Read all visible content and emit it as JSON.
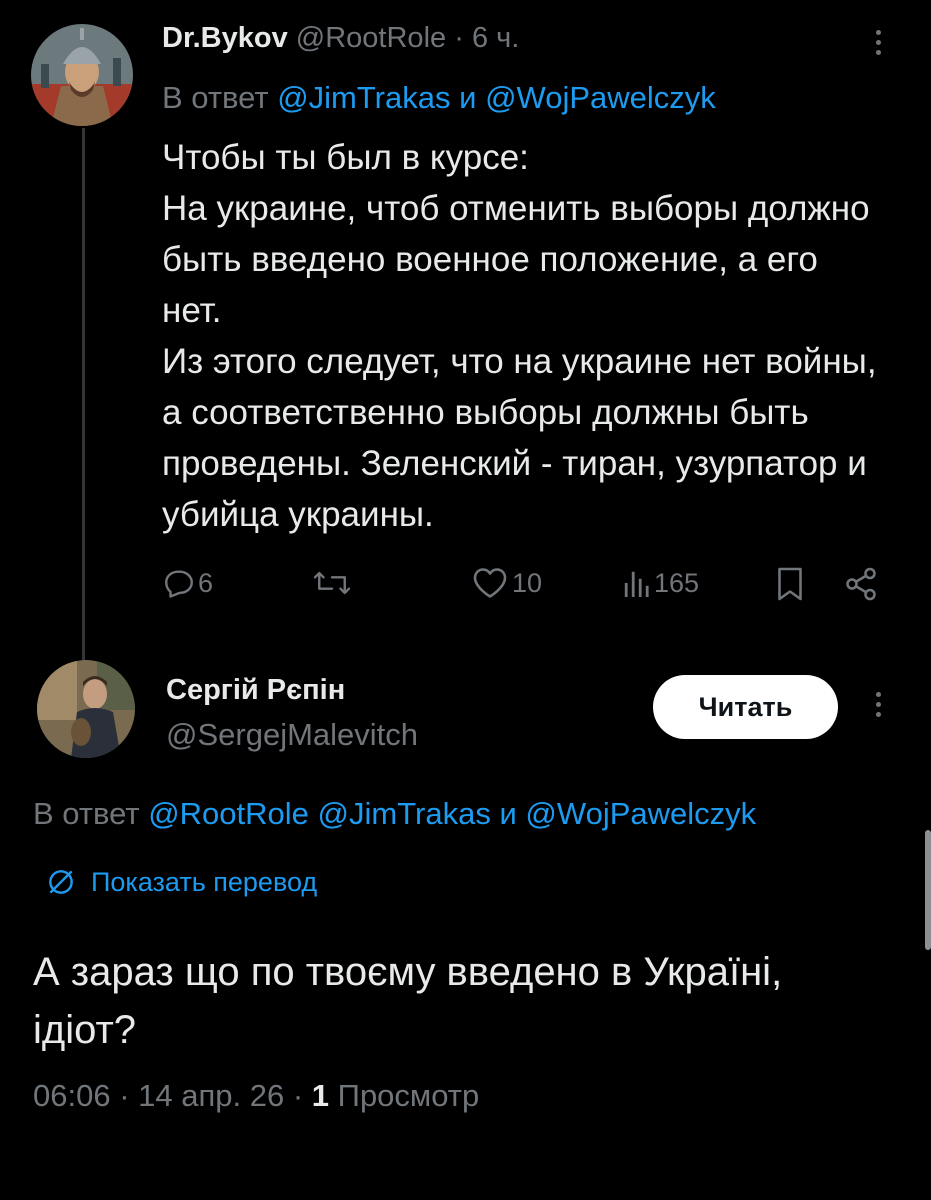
{
  "tweet1": {
    "author_name": "Dr.Bykov",
    "author_handle": "@RootRole",
    "separator": "·",
    "time_ago": "6 ч.",
    "reply_prefix": "В ответ",
    "reply_user1": "@JimTrakas",
    "reply_and": "и",
    "reply_user2": "@WojPawelczyk",
    "text": "Чтобы ты был в курсе:\nНа украине, чтоб отменить выборы должно быть введено военное положение, а его нет.\nИз этого следует, что на украине нет войны, а соответственно выборы должны быть проведены. Зеленский - тиран, узурпатор и убийца украины.",
    "replies": "6",
    "likes": "10",
    "views": "165"
  },
  "tweet2": {
    "author_name": "Сергій Рєпін",
    "author_handle": "@SergejMalevitch",
    "follow_label": "Читать",
    "reply_prefix": "В ответ",
    "reply_user1": "@RootRole",
    "reply_user2": "@JimTrakas",
    "reply_and": "и",
    "reply_user3": "@WojPawelczyk",
    "translate_label": "Показать перевод",
    "text": "А зараз що по твоєму введено в Україні, ідіот?",
    "time": "06:06",
    "date": "14 апр. 26",
    "views_count": "1",
    "views_label": "Просмотр"
  },
  "colors": {
    "background": "#000000",
    "text": "#e7e9ea",
    "muted": "#71767b",
    "accent": "#1d9bf0"
  }
}
